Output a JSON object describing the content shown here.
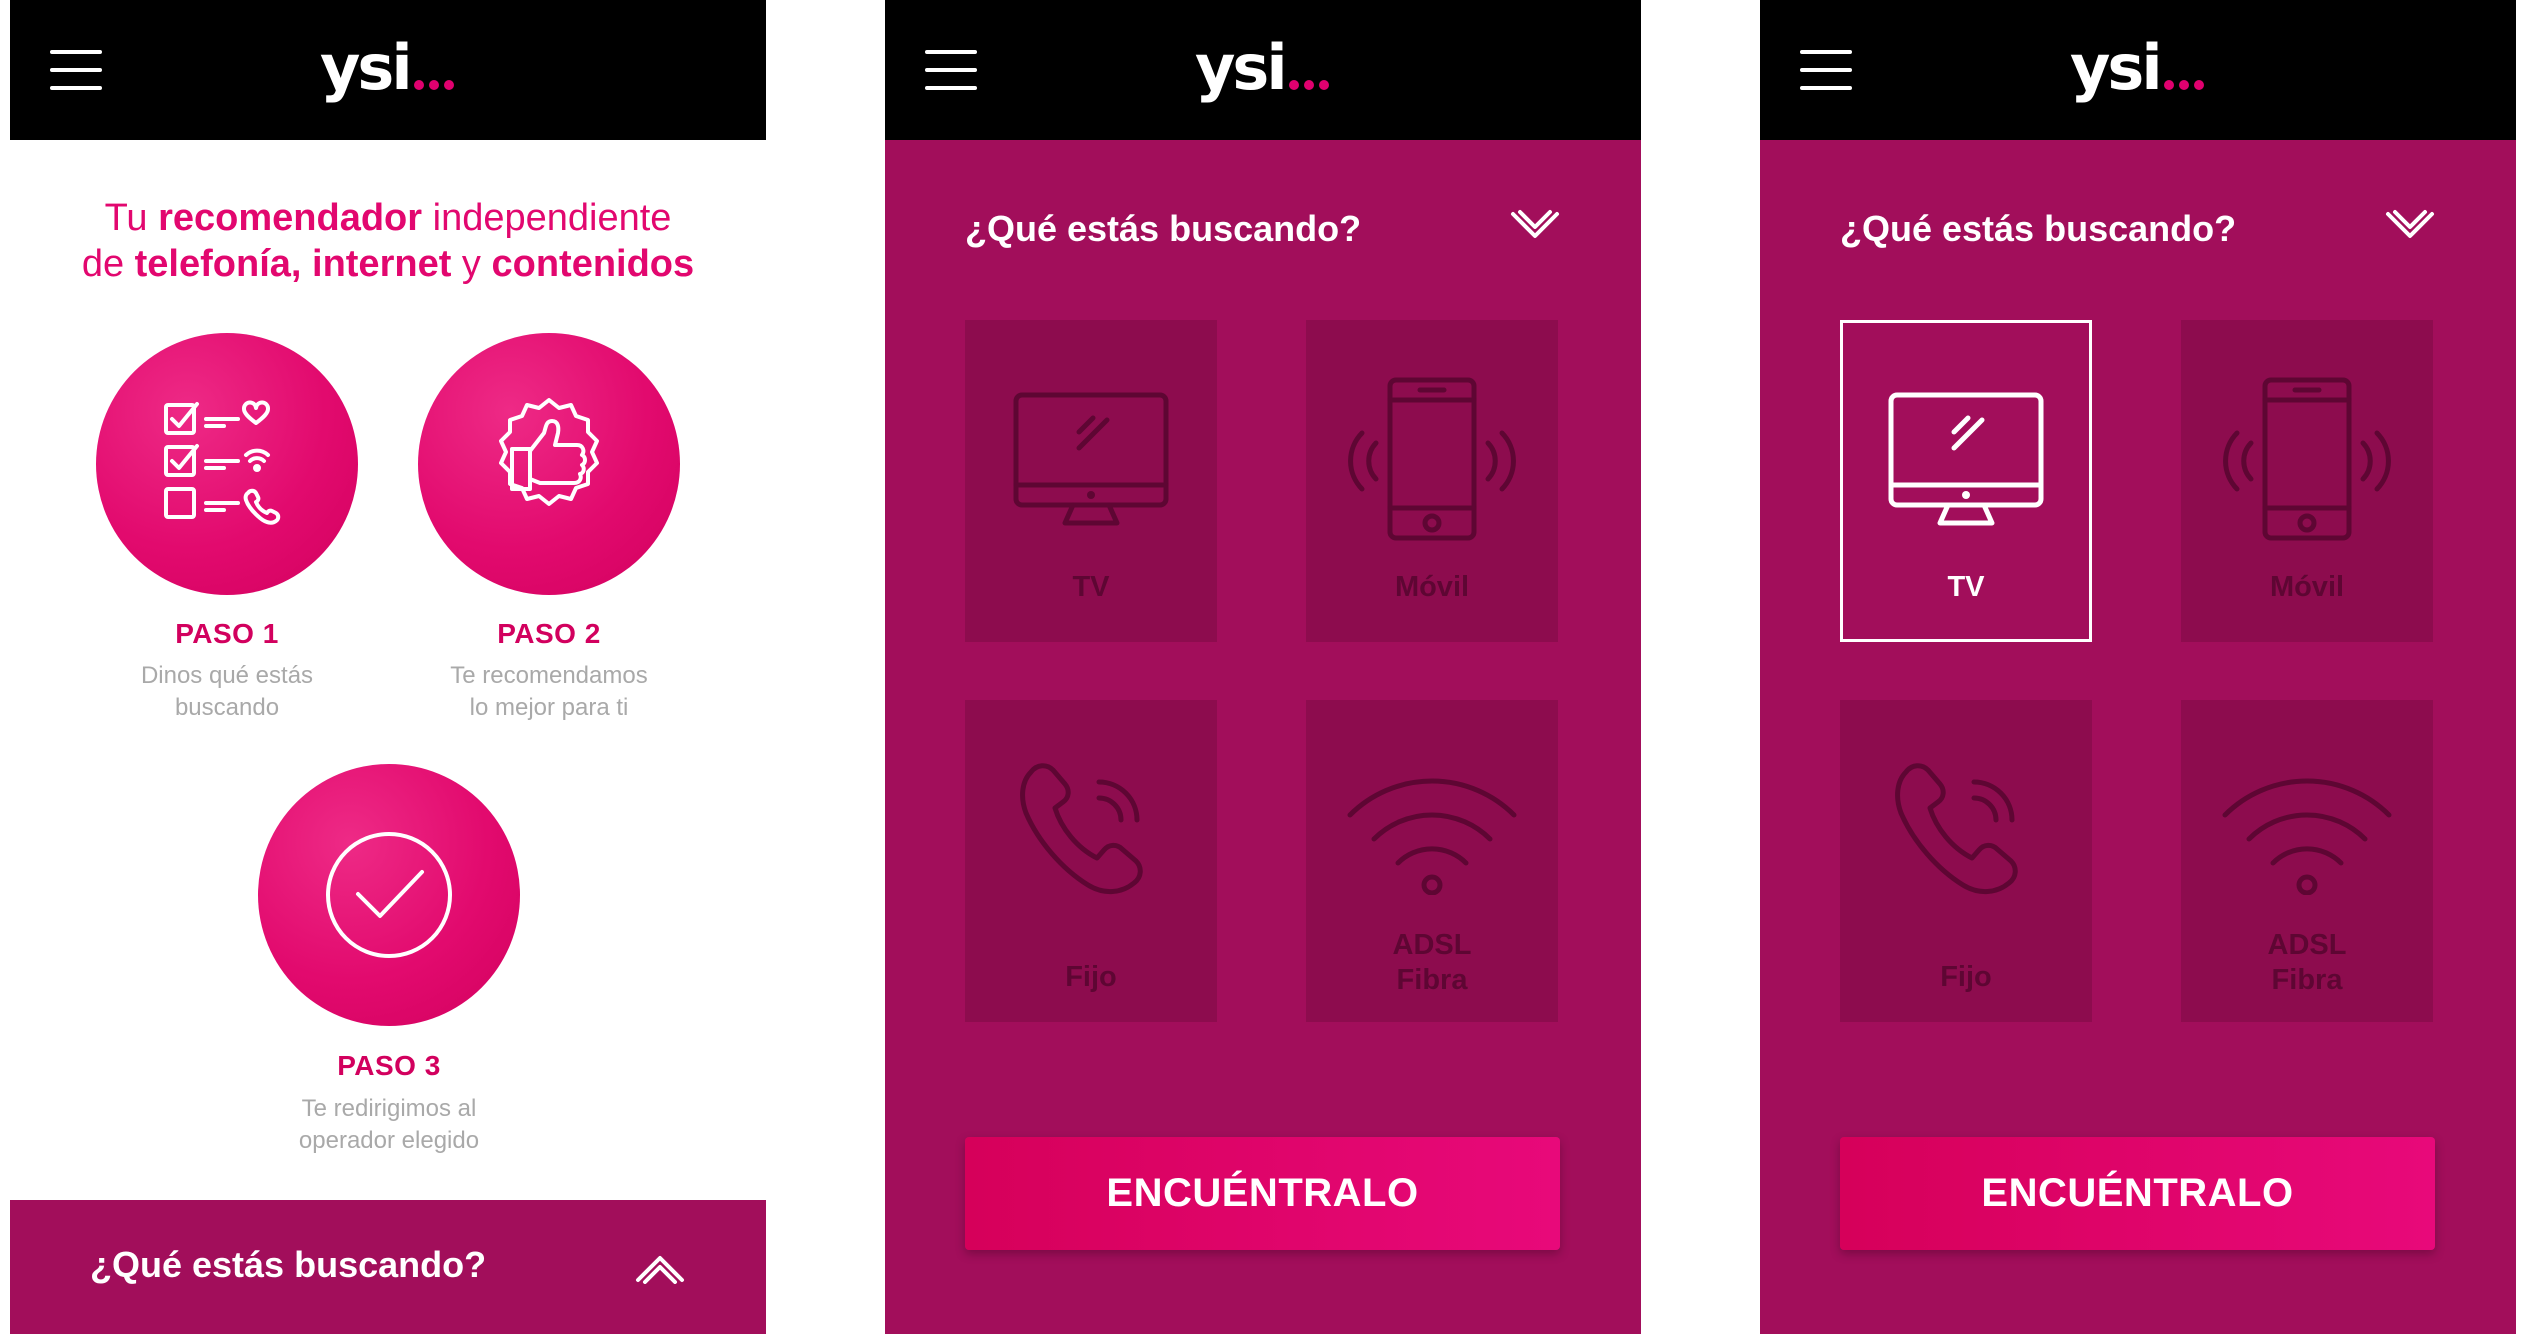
{
  "brand": {
    "logo_text": "ysi",
    "accent": "#e2076f",
    "magenta_bg": "#a20e5b",
    "tile_bg": "#8d0c4e",
    "tile_label": "#5e0633"
  },
  "intro": {
    "headline_line1": [
      "Tu ",
      "recomendador",
      " independiente"
    ],
    "headline_line2": [
      "de ",
      "telefonía, internet",
      " y ",
      "contenidos"
    ],
    "steps": [
      {
        "title": "PASO 1",
        "desc1": "Dinos qué estás",
        "desc2": "buscando",
        "icon": "checklist-icon"
      },
      {
        "title": "PASO 2",
        "desc1": "Te recomendamos",
        "desc2": "lo mejor para ti",
        "icon": "thumbs-up-badge-icon"
      },
      {
        "title": "PASO 3",
        "desc1": "Te redirigimos al",
        "desc2": "operador elegido",
        "icon": "check-circle-icon"
      }
    ],
    "bottom_question": "¿Qué estás buscando?"
  },
  "selector": {
    "question": "¿Qué estás buscando?",
    "options": [
      {
        "label": "TV",
        "icon": "tv-icon"
      },
      {
        "label": "Móvil",
        "icon": "mobile-icon"
      },
      {
        "label": "Fijo",
        "icon": "phone-icon"
      },
      {
        "label1": "ADSL",
        "label2": "Fibra",
        "icon": "wifi-icon"
      }
    ],
    "cta": "ENCUÉNTRALO"
  },
  "selected_state": {
    "selected_option": "TV"
  }
}
